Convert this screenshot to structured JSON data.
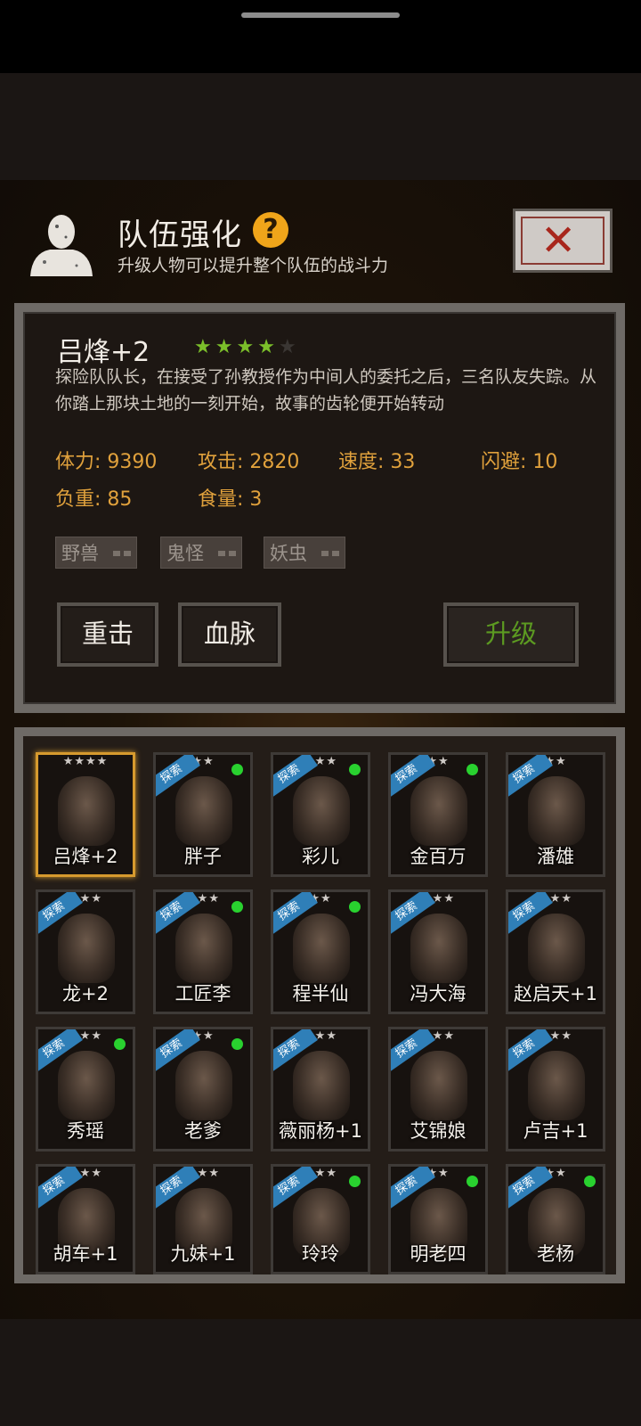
{
  "header": {
    "title": "队伍强化",
    "help_icon": "question-icon",
    "subtitle": "升级人物可以提升整个队伍的战斗力",
    "close_icon": "close-icon"
  },
  "hero": {
    "name": "吕烽+2",
    "stars_filled": 4,
    "stars_total": 5,
    "star_color": "#7bbf2a",
    "description": "探险队队长，在接受了孙教授作为中间人的委托之后，三名队友失踪。从你踏上那块土地的一刻开始，故事的齿轮便开始转动",
    "stats": {
      "stamina": "体力: 9390",
      "attack": "攻击: 2820",
      "speed": "速度: 33",
      "dodge": "闪避: 10",
      "load": "负重: 85",
      "food": "食量: 3"
    },
    "tags": [
      "野兽",
      "鬼怪",
      "妖虫"
    ],
    "buttons": {
      "heavy_strike": "重击",
      "bloodline": "血脉",
      "upgrade": "升级"
    }
  },
  "explore_badge": "探索",
  "characters": [
    {
      "name": "吕烽+2",
      "stars": "★★★★",
      "explore": false,
      "online": false,
      "selected": true
    },
    {
      "name": "胖子",
      "stars": "★★",
      "explore": true,
      "online": true,
      "selected": false
    },
    {
      "name": "彩儿",
      "stars": "★★★",
      "explore": true,
      "online": true,
      "selected": false
    },
    {
      "name": "金百万",
      "stars": "★★",
      "explore": true,
      "online": true,
      "selected": false
    },
    {
      "name": "潘雄",
      "stars": "★★",
      "explore": true,
      "online": false,
      "selected": false
    },
    {
      "name": "龙+2",
      "stars": "★★★",
      "explore": true,
      "online": false,
      "selected": false
    },
    {
      "name": "工匠李",
      "stars": "★★★",
      "explore": true,
      "online": true,
      "selected": false
    },
    {
      "name": "程半仙",
      "stars": "★★",
      "explore": true,
      "online": true,
      "selected": false
    },
    {
      "name": "冯大海",
      "stars": "★★★",
      "explore": true,
      "online": false,
      "selected": false
    },
    {
      "name": "赵启天+1",
      "stars": "★★★",
      "explore": true,
      "online": false,
      "selected": false
    },
    {
      "name": "秀瑶",
      "stars": "★★★",
      "explore": true,
      "online": true,
      "selected": false
    },
    {
      "name": "老爹",
      "stars": "★★",
      "explore": true,
      "online": true,
      "selected": false
    },
    {
      "name": "薇丽杨+1",
      "stars": "★★★",
      "explore": true,
      "online": false,
      "selected": false
    },
    {
      "name": "艾锦娘",
      "stars": "★★★",
      "explore": true,
      "online": false,
      "selected": false
    },
    {
      "name": "卢吉+1",
      "stars": "★★★",
      "explore": true,
      "online": false,
      "selected": false
    },
    {
      "name": "胡车+1",
      "stars": "★★★",
      "explore": true,
      "online": false,
      "selected": false
    },
    {
      "name": "九妹+1",
      "stars": "★★★",
      "explore": true,
      "online": false,
      "selected": false
    },
    {
      "name": "玲玲",
      "stars": "★★★",
      "explore": true,
      "online": true,
      "selected": false
    },
    {
      "name": "明老四",
      "stars": "★★",
      "explore": true,
      "online": true,
      "selected": false
    },
    {
      "name": "老杨",
      "stars": "★★",
      "explore": true,
      "online": true,
      "selected": false
    }
  ]
}
